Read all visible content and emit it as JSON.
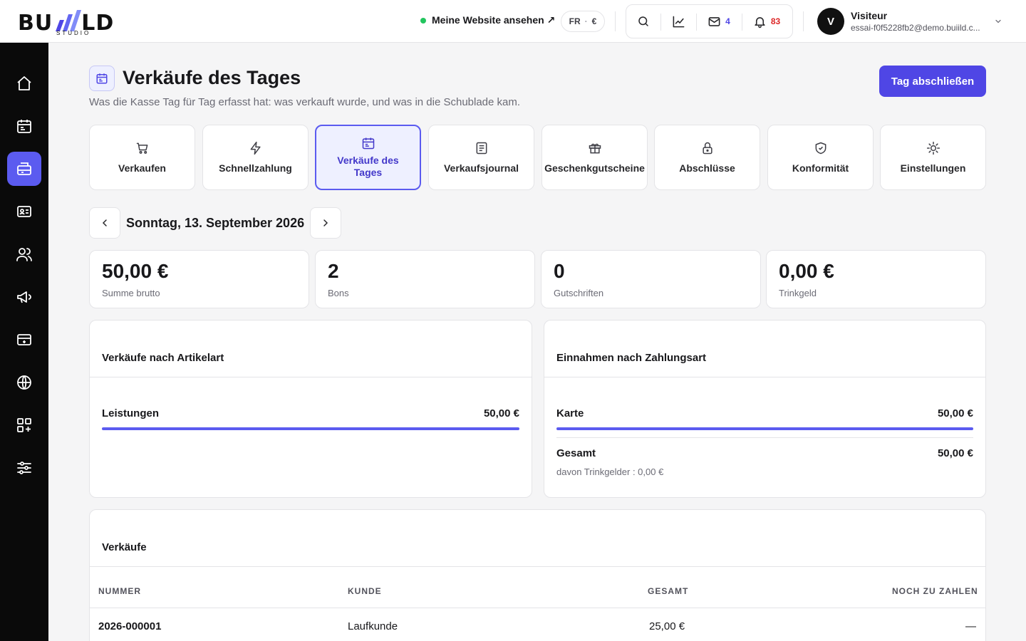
{
  "brand": {
    "logo": "BUIILD",
    "sub": "STUDIO"
  },
  "topbar": {
    "site_link": "Meine Website ansehen ↗",
    "lang": "FR",
    "currency": "€",
    "mail_count": "4",
    "notif_count": "83",
    "user_initial": "V",
    "user_name": "Visiteur",
    "user_email": "essai-f0f5228fb2@demo.buiild.c..."
  },
  "page": {
    "title": "Verkäufe des Tages",
    "subtitle": "Was die Kasse Tag für Tag erfasst hat: was verkauft wurde, und was in die Schublade kam.",
    "close_button": "Tag abschließen"
  },
  "tabs": [
    {
      "label": "Verkaufen",
      "icon": "cart-icon"
    },
    {
      "label": "Schnellzahlung",
      "icon": "bolt-icon"
    },
    {
      "label": "Verkäufe des Tages",
      "icon": "calendar-icon"
    },
    {
      "label": "Verkaufsjournal",
      "icon": "document-icon"
    },
    {
      "label": "Geschenkgutscheine",
      "icon": "gift-icon"
    },
    {
      "label": "Abschlüsse",
      "icon": "lock-icon"
    },
    {
      "label": "Konformität",
      "icon": "shield-icon"
    },
    {
      "label": "Einstellungen",
      "icon": "sun-gear-icon"
    }
  ],
  "date": {
    "label": "Sonntag, 13. September 2026"
  },
  "stats": [
    {
      "value": "50,00 €",
      "label": "Summe brutto"
    },
    {
      "value": "2",
      "label": "Bons"
    },
    {
      "value": "0",
      "label": "Gutschriften"
    },
    {
      "value": "0,00 €",
      "label": "Trinkgeld"
    }
  ],
  "by_type": {
    "title": "Verkäufe nach Artikelart",
    "rows": [
      {
        "label": "Leistungen",
        "value": "50,00 €",
        "share": 1.0
      }
    ]
  },
  "by_payment": {
    "title": "Einnahmen nach Zahlungsart",
    "rows": [
      {
        "label": "Karte",
        "value": "50,00 €",
        "share": 1.0
      }
    ],
    "total_label": "Gesamt",
    "total_value": "50,00 €",
    "tips_note": "davon Trinkgelder : 0,00 €"
  },
  "sales": {
    "title": "Verkäufe",
    "columns": [
      "NUMMER",
      "KUNDE",
      "GESAMT",
      "NOCH ZU ZAHLEN"
    ],
    "rows": [
      {
        "number": "2026-000001",
        "customer": "Laufkunde",
        "total": "25,00 €",
        "due": "—"
      }
    ]
  },
  "colors": {
    "accent": "#4f46e5",
    "sidebar": "#0a0a0a",
    "active_nav": "#5b5bf0"
  }
}
